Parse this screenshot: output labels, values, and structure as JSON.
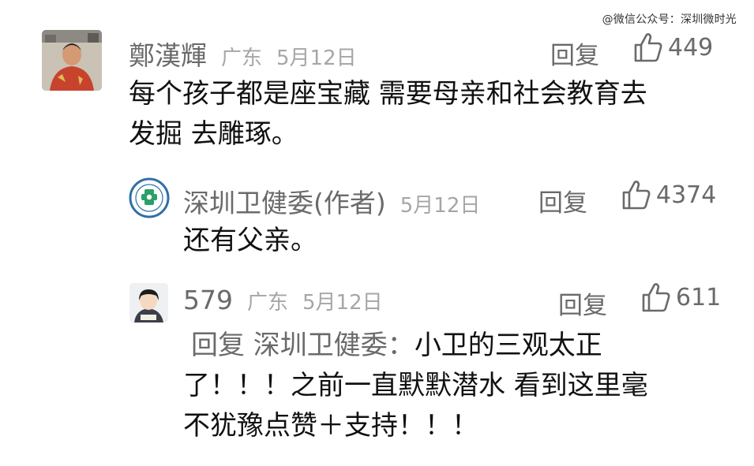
{
  "watermark": "@微信公众号：深圳微时光",
  "comments": [
    {
      "author": "鄭漢輝",
      "region": "广东",
      "date": "5月12日",
      "reply_label": "回复",
      "likes": "449",
      "lines": [
        "每个孩子都是座宝藏 需要母亲和社会教育去",
        "发掘 去雕琢。"
      ]
    },
    {
      "author": "深圳卫健委(作者)",
      "date": "5月12日",
      "reply_label": "回复",
      "likes": "4374",
      "lines": [
        "还有父亲。"
      ]
    },
    {
      "author": "579",
      "region": "广东",
      "date": "5月12日",
      "reply_label": "回复",
      "likes": "611",
      "reply_prefix": "回复 深圳卫健委：",
      "lines": [
        "小卫的三观太正",
        "了！！！之前一直默默潜水 看到这里毫",
        "不犹豫点赞＋支持！！！"
      ]
    }
  ]
}
